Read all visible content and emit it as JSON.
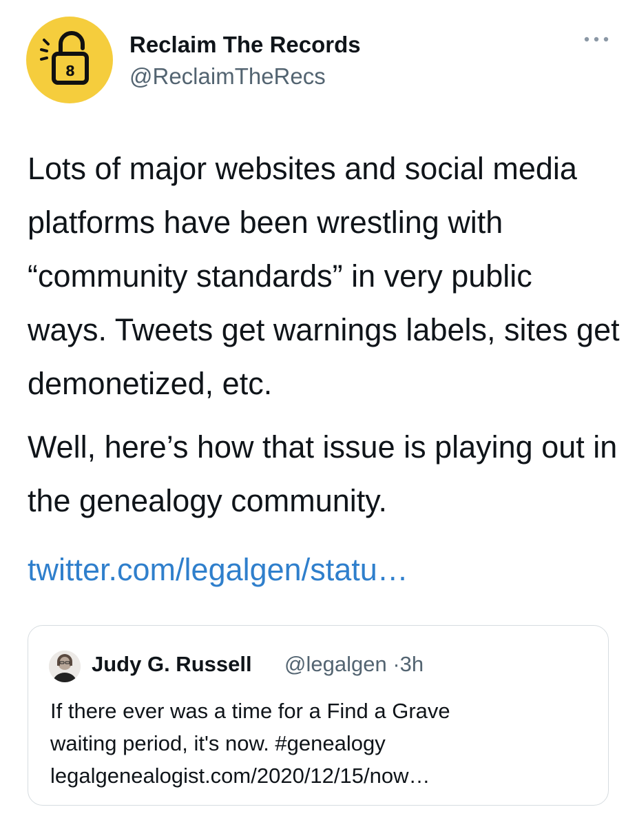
{
  "author": {
    "display_name": "Reclaim The Records",
    "handle": "@ReclaimTheRecs",
    "avatar_icon": "padlock-icon",
    "avatar_color": "#f5cd3d"
  },
  "more_icon": "more-horizontal-icon",
  "tweet": {
    "paragraph_1": "Lots of major websites and social media platforms have been wrestling with “community standards” in very public ways. Tweets get warnings labels, sites get demonetized, etc.",
    "paragraph_2": "Well, here’s how that issue is playing out in the genealogy community.",
    "link": "twitter.com/legalgen/statu…",
    "link_color": "#2f7fcc"
  },
  "quoted_tweet": {
    "display_name": "Judy G. Russell",
    "handle": "@legalgen",
    "separator": "·",
    "time": "3h",
    "text_line_1": "If there ever was a time for a Find a Grave",
    "text_line_2": "waiting period, it's now. #genealogy",
    "text_line_3": "legalgenealogist.com/2020/12/15/now…"
  }
}
